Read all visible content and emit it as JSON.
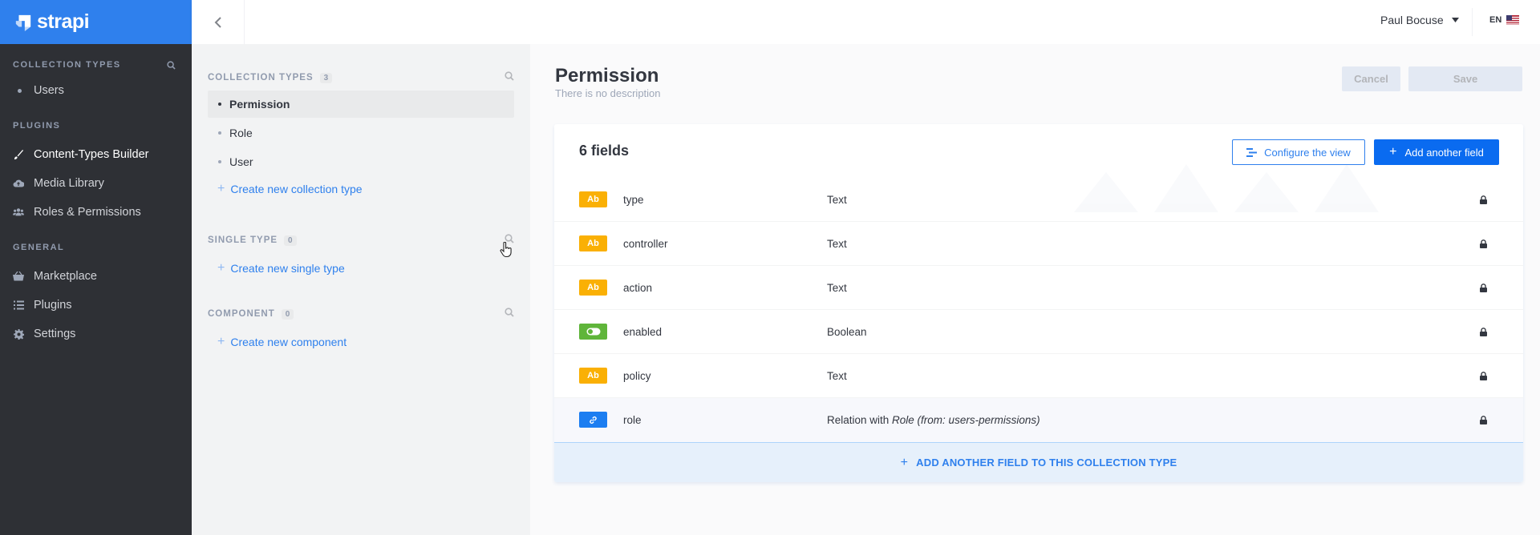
{
  "brand": {
    "name": "strapi",
    "color": "#2f80ed"
  },
  "leftnav": {
    "collection_types": {
      "heading": "COLLECTION TYPES",
      "items": [
        {
          "label": "Users"
        }
      ]
    },
    "plugins": {
      "heading": "PLUGINS",
      "items": [
        {
          "label": "Content-Types Builder",
          "icon": "paint-brush-icon",
          "active": true
        },
        {
          "label": "Media Library",
          "icon": "cloud-upload-icon"
        },
        {
          "label": "Roles & Permissions",
          "icon": "users-icon"
        }
      ]
    },
    "general": {
      "heading": "GENERAL",
      "items": [
        {
          "label": "Marketplace",
          "icon": "basket-icon"
        },
        {
          "label": "Plugins",
          "icon": "list-icon"
        },
        {
          "label": "Settings",
          "icon": "gear-icon"
        }
      ]
    }
  },
  "topbar": {
    "user": "Paul Bocuse",
    "lang": "EN"
  },
  "builder": {
    "collection_types": {
      "heading": "COLLECTION TYPES",
      "count": "3",
      "items": [
        "Permission",
        "Role",
        "User"
      ],
      "create": "Create new collection type"
    },
    "single_type": {
      "heading": "SINGLE TYPE",
      "count": "0",
      "create": "Create new single type"
    },
    "component": {
      "heading": "COMPONENT",
      "count": "0",
      "create": "Create new component"
    }
  },
  "main": {
    "title": "Permission",
    "description": "There is no description",
    "cancel": "Cancel",
    "save": "Save",
    "fields_count": "6 fields",
    "configure": "Configure the view",
    "add_field": "Add another field",
    "fields": [
      {
        "name": "type",
        "type": "Text",
        "badge": "Ab",
        "color": "#fab005"
      },
      {
        "name": "controller",
        "type": "Text",
        "badge": "Ab",
        "color": "#fab005"
      },
      {
        "name": "action",
        "type": "Text",
        "badge": "Ab",
        "color": "#fab005"
      },
      {
        "name": "enabled",
        "type": "Boolean",
        "badge": "toggle",
        "color": "#5fb53a"
      },
      {
        "name": "policy",
        "type": "Text",
        "badge": "Ab",
        "color": "#fab005"
      },
      {
        "name": "role",
        "type_prefix": "Relation with ",
        "type_em": "Role (from: users-permissions)",
        "badge": "link",
        "color": "#1c7ef1"
      }
    ],
    "add_bar": "ADD ANOTHER FIELD TO THIS COLLECTION TYPE"
  }
}
